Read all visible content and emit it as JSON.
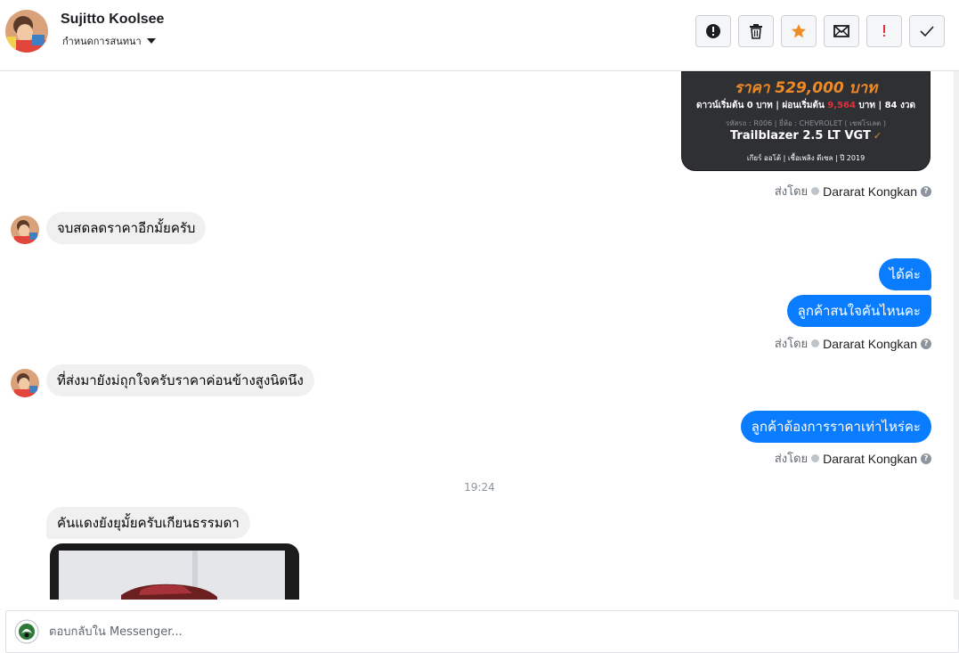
{
  "header": {
    "contact_name": "Sujitto Koolsee",
    "assign_label": "กำหนดการสนทนา",
    "actions": [
      {
        "name": "spam-button",
        "icon": "alert-circle-icon"
      },
      {
        "name": "delete-button",
        "icon": "trash-icon"
      },
      {
        "name": "star-button",
        "icon": "star-icon",
        "color": "#f08a24"
      },
      {
        "name": "mark-unread-button",
        "icon": "envelope-icon"
      },
      {
        "name": "follow-up-button",
        "icon": "exclamation-icon",
        "color": "#e0303a"
      },
      {
        "name": "mark-done-button",
        "icon": "check-icon"
      }
    ]
  },
  "car_card": {
    "price": "ราคา 529,000 บาท",
    "down_label": "ดาวน์เริ่มต้น 0 บาท | ผ่อนเริ่มต้น ",
    "monthly": "9,564",
    "terms_suffix": " บาท | 84 งวด",
    "meta": "รหัสรถ : R006 | ยี่ห้อ : CHEVROLET ( เชฟโรเลต )",
    "model": "Trailblazer 2.5 LT VGT",
    "specs": "เกียร์ ออโต้   |   เชื้อเพลิง ดีเซล   |   ปี 2019"
  },
  "sent_by_label": "ส่งโดย",
  "agent_name": "Dararat Kongkan",
  "messages": {
    "in_1": "จบสดลดราคาอีกมั้ยครับ",
    "out_1": "ได้ค่ะ",
    "out_2": "ลูกค้าสนใจคันไหนคะ",
    "in_2": "ที่ส่งมายังม่ถุกใจครับราคาค่อนข้างสูงนิดนึง",
    "out_3": "ลูกค้าต้องการราคาเท่าไหร่คะ",
    "time": "19:24",
    "in_3": "คันแดงยังยุมั้ยครับเกียนธรรมดา"
  },
  "composer": {
    "placeholder": "ตอบกลับใน Messenger..."
  },
  "colors": {
    "outgoing_bubble": "#0a7cff",
    "incoming_bubble": "#f0f0f0",
    "accent_orange": "#f08a24",
    "accent_red": "#e0303a"
  }
}
